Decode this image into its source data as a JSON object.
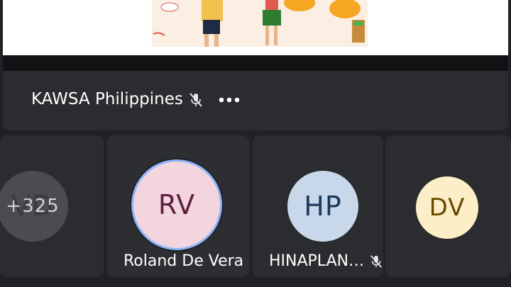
{
  "presenter": {
    "name": "KAWSA Philippines",
    "more_icon": "more-horiz-icon",
    "mic_icon": "mic-off-icon"
  },
  "participants": [
    {
      "initials": "VD",
      "overflow_count": "+325",
      "bg": "#4a4c50",
      "fg": "#9aa0a6"
    },
    {
      "initials": "RV",
      "name": "Roland De Vera",
      "bg": "#f3d5df",
      "fg": "#5c1f3d",
      "ring": "#8ab4f8"
    },
    {
      "initials": "HP",
      "name": "HINAPLAN…",
      "bg": "#c8d8ea",
      "fg": "#1a3a5e",
      "mic_icon": "mic-off-icon"
    },
    {
      "initials": "DV",
      "bg": "#fcefc7",
      "fg": "#6b4a00"
    }
  ]
}
